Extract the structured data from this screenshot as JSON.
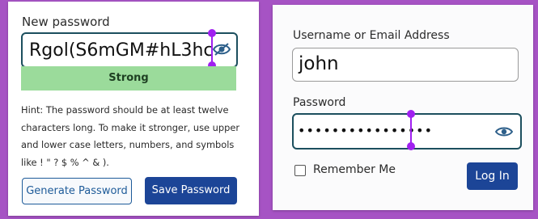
{
  "reset_password_form": {
    "new_password_label": "New password",
    "new_password_value": "Rgol(S6mGM#hL3hc",
    "strength_text": "Strong",
    "hint_lines": [
      "Hint: The password should be at least twelve",
      "characters long. To make it stronger, use upper",
      "and lower case letters, numbers, and symbols",
      "like ! \" ? $ % ^ & )."
    ],
    "generate_button": "Generate Password",
    "save_button": "Save Password"
  },
  "login_form": {
    "username_label": "Username or Email Address",
    "username_value": "john",
    "password_label": "Password",
    "password_value": "••••••••••••••••",
    "remember_label": "Remember Me",
    "login_button": "Log In"
  },
  "colors": {
    "page_background": "#a653c4",
    "field_border": "#1c4f5e",
    "strength_bar": "#9bdb9b",
    "primary_button": "#1c4597",
    "caret_marker": "#a020f0"
  },
  "icons": [
    "eye-hidden-icon",
    "eye-icon",
    "checkbox-unchecked-icon"
  ]
}
